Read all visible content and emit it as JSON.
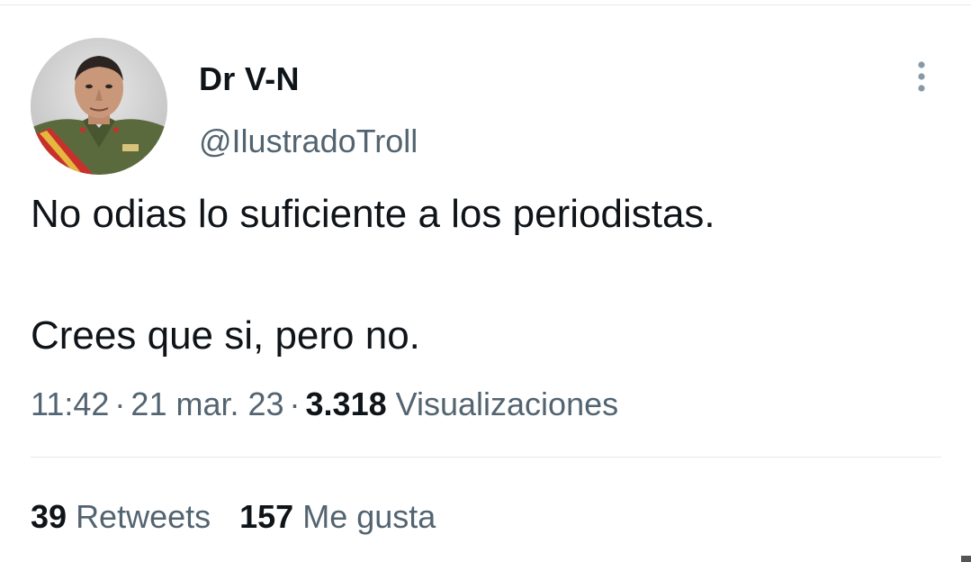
{
  "tweet": {
    "author": {
      "display_name": "Dr V-N",
      "handle": "@IlustradoTroll",
      "avatar": "avatar-photo"
    },
    "text_lines": [
      "No odias lo suficiente a los periodistas.",
      "Crees que si, pero no."
    ],
    "meta": {
      "time": "11:42",
      "separator": "·",
      "date": "21 mar. 23",
      "views_count": "3.318",
      "views_label": "Visualizaciones"
    },
    "stats": {
      "retweets_count": "39",
      "retweets_label": "Retweets",
      "likes_count": "157",
      "likes_label": "Me gusta"
    },
    "more_icon": "more-vertical-icon"
  },
  "colors": {
    "text_primary": "#0f1419",
    "text_secondary": "#536471",
    "divider": "#e6e9eb",
    "more_icon": "#8899a6"
  }
}
